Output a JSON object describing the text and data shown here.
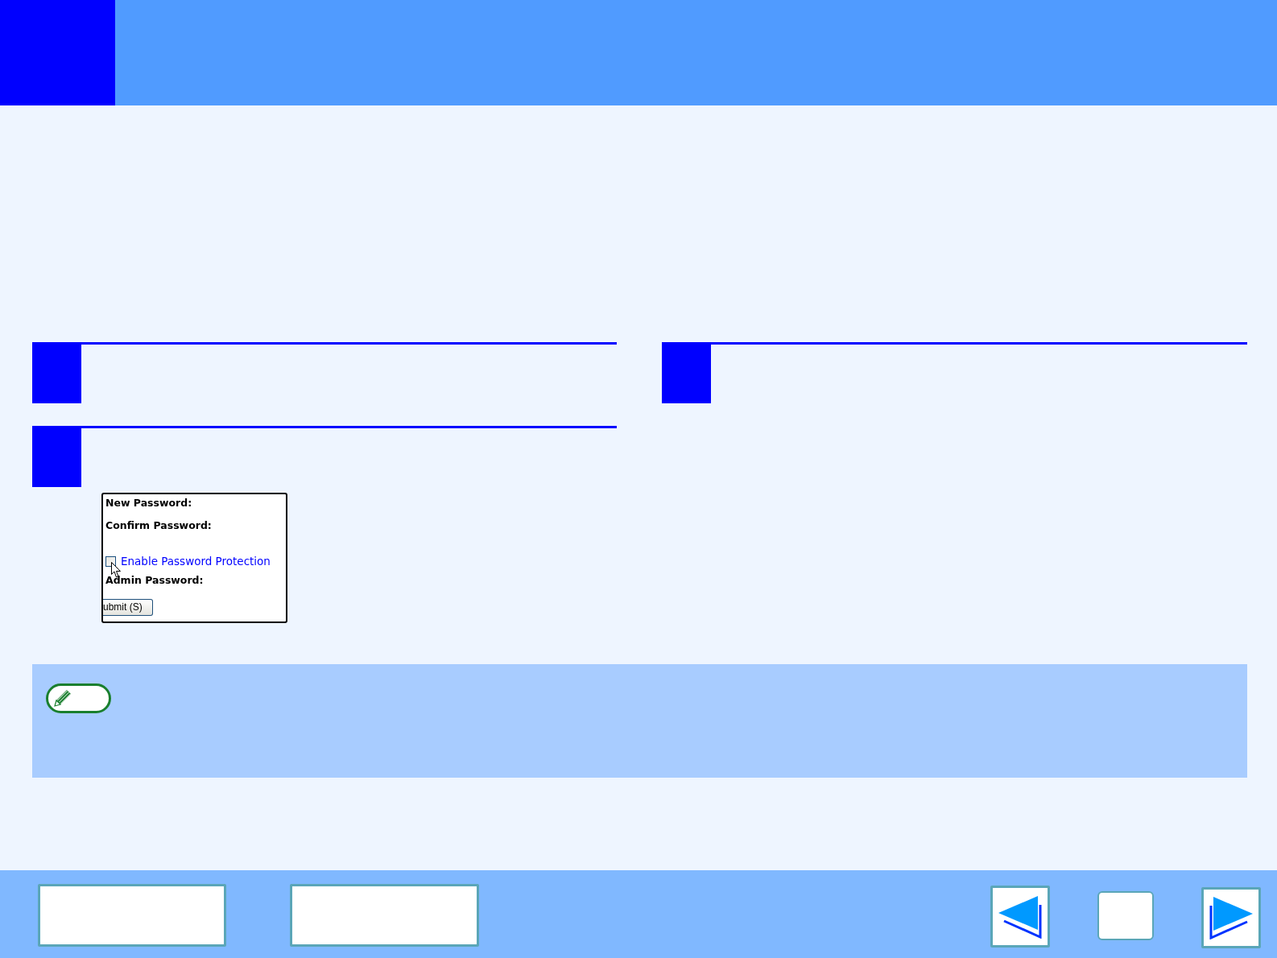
{
  "password_form": {
    "labels": [
      "New Password:",
      "Confirm Password:"
    ],
    "checkbox": {
      "label": "Enable Password Protection",
      "checked": false
    },
    "admin_label": "Admin Password:",
    "submit_button": "ubmit (S)"
  }
}
